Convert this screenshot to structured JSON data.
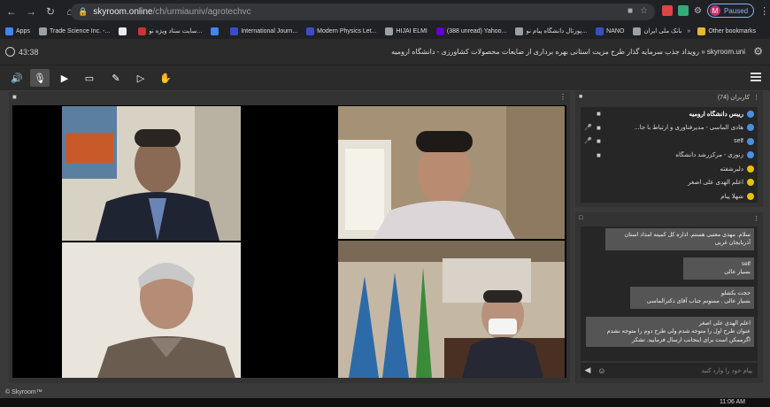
{
  "browser": {
    "url_host": "skyroom.online",
    "url_path": "/ch/urmiauniv/agrotechvc",
    "profile_initial": "M",
    "paused_label": "Paused",
    "other_bookmarks": "Other bookmarks",
    "bookmarks": [
      {
        "label": "Apps",
        "color": "#4285f4"
      },
      {
        "label": "Trade Science Inc. -...",
        "color": "#9aa0a6"
      },
      {
        "label": "",
        "color": "#e8eaed"
      },
      {
        "label": "سایت ستاد ویژه نو...",
        "color": "#c33"
      },
      {
        "label": "",
        "color": "#4285f4"
      },
      {
        "label": "International Journ...",
        "color": "#3b4cca"
      },
      {
        "label": "Modern Physics Let...",
        "color": "#3b4cca"
      },
      {
        "label": "HIJAI ELMI",
        "color": "#9aa0a6"
      },
      {
        "label": "(388 unread) Yahoo...",
        "color": "#6001d2"
      },
      {
        "label": "پورتال دانشگاه پیام نو...",
        "color": "#9aa0a6"
      },
      {
        "label": "NANO",
        "color": "#3b4cca"
      },
      {
        "label": "بانک ملی ایران",
        "color": "#9aa0a6"
      }
    ]
  },
  "app": {
    "timer": "43:38",
    "room_title": "skyroom.uni « رویداد جذب سرمایه گذار طرح مزیت استانی بهره برداری از ضایعات محصولات کشاورزی - دانشگاه ارومیه"
  },
  "toolbar": {
    "tools": [
      "speaker-icon",
      "mic-muted-icon",
      "camera-icon",
      "screen-share-icon",
      "whiteboard-icon",
      "media-icon",
      "raise-hand-icon"
    ]
  },
  "users_panel": {
    "title": "کاربران (74)",
    "users": [
      {
        "name": "رییس دانشگاه ارومیه",
        "bold": true,
        "mic": false,
        "cam": true,
        "color": "#4a90e2"
      },
      {
        "name": "هادی الماسی - مدیرفناوری و ارتباط با جا...",
        "bold": false,
        "mic": true,
        "cam": true,
        "color": "#4a90e2"
      },
      {
        "name": "self",
        "bold": false,
        "mic": true,
        "cam": true,
        "color": "#4a90e2"
      },
      {
        "name": "زنوزی - مرکزرشد دانشگاه",
        "bold": false,
        "mic": false,
        "cam": true,
        "color": "#4a90e2"
      },
      {
        "name": "دلیرشفته",
        "bold": false,
        "mic": false,
        "cam": false,
        "color": "#e6c300"
      },
      {
        "name": "اعلم الهدی علی اصغر",
        "bold": false,
        "mic": false,
        "cam": false,
        "color": "#e6c300"
      },
      {
        "name": "شهلا پیام",
        "bold": false,
        "mic": false,
        "cam": false,
        "color": "#e6c300"
      }
    ]
  },
  "chat_panel": {
    "messages": [
      {
        "sender": "",
        "text": "سلام. مهدی معتبی هستم. اداره کل کمیته امداد استان آذربایجان غربی"
      },
      {
        "sender": "self",
        "text": "بسیار عالی"
      },
      {
        "sender": "حجت بکشلو",
        "text": "بسیار عالی . ممنونم جناب آقای دکترالماسی"
      },
      {
        "sender": "اعلم الهدی علی اصغر",
        "text": "عنوان طرح اول را متوجه شدم ولی طرح دوم را متوجه نشدم اگرممکن است برای اینجانب ارسال فرمایید. تشکر"
      }
    ],
    "input_placeholder": "پیام خود را وارد کنید"
  },
  "footer": {
    "brand": "© Skyroom™",
    "clock": "11:06 AM"
  }
}
